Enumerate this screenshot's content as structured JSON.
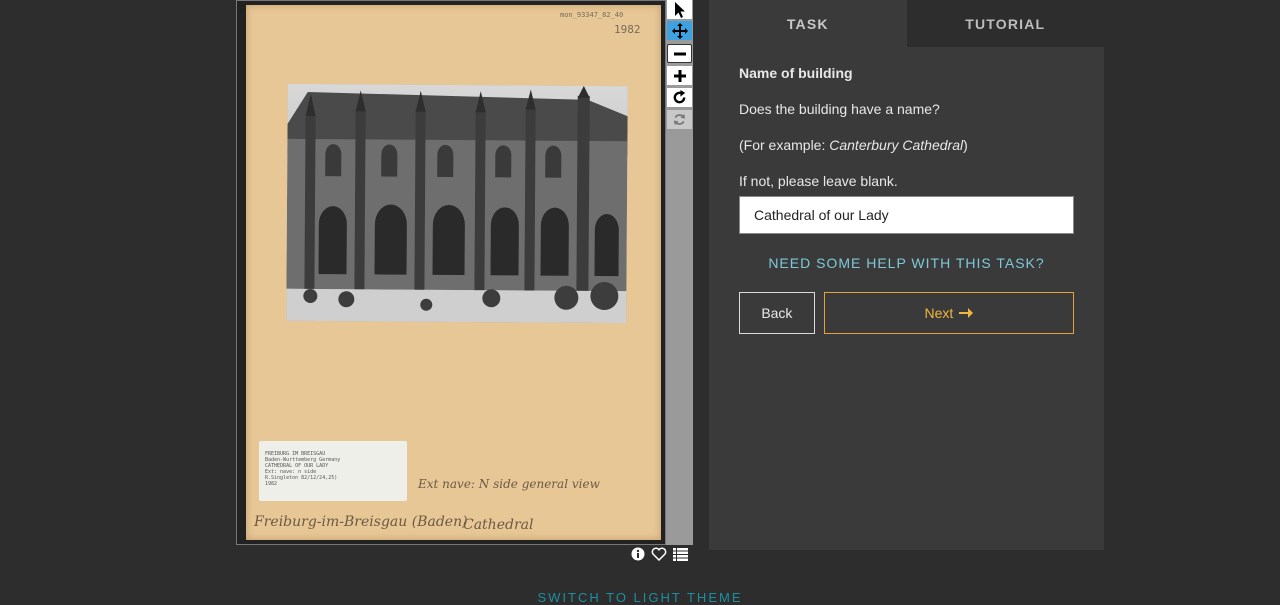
{
  "subject": {
    "corner_code": "mon_93347_82_40",
    "corner_year": "1982",
    "label_card_lines": [
      "FREIBURG IM BREISGAU",
      "Baden-Wurttemberg Germany",
      "CATHEDRAL OF OUR LADY",
      "Ext: nave: n side",
      "R.Singleton 82/12/24,25)",
      "1982"
    ],
    "handwriting_note": "Ext nave: N side general view",
    "handwriting_place": "Freiburg-im-Breisgau (Baden)",
    "handwriting_type": "Cathedral"
  },
  "toolbar": {
    "tools": [
      {
        "name": "pointer-tool",
        "icon": "arrow-pointer-icon"
      },
      {
        "name": "move-tool",
        "icon": "move-arrows-icon",
        "active": true
      },
      {
        "name": "zoom-out-tool",
        "icon": "minus-icon"
      },
      {
        "name": "zoom-in-tool",
        "icon": "plus-icon"
      },
      {
        "name": "rotate-tool",
        "icon": "rotate-icon"
      },
      {
        "name": "reset-tool",
        "icon": "refresh-icon",
        "disabled": true
      }
    ]
  },
  "meta_icons": [
    "info-icon",
    "heart-icon",
    "list-icon"
  ],
  "tabs": {
    "task": "TASK",
    "tutorial": "TUTORIAL"
  },
  "task": {
    "title": "Name of building",
    "question": "Does the building have a name?",
    "example_prefix": "(For example: ",
    "example_value": "Canterbury Cathedral",
    "example_suffix": ")",
    "instruction": "If not, please leave blank.",
    "answer_value": "Cathedral of our Lady",
    "help_link": "NEED SOME HELP WITH THIS TASK?",
    "back_label": "Back",
    "next_label": "Next"
  },
  "footer": {
    "theme_link": "SWITCH TO LIGHT THEME"
  },
  "colors": {
    "background": "#2d2d2d",
    "panel": "#3a3a3a",
    "accent_next": "#f0b53e",
    "help_link": "#7ec8d8",
    "active_tool": "#3fa2e0"
  }
}
